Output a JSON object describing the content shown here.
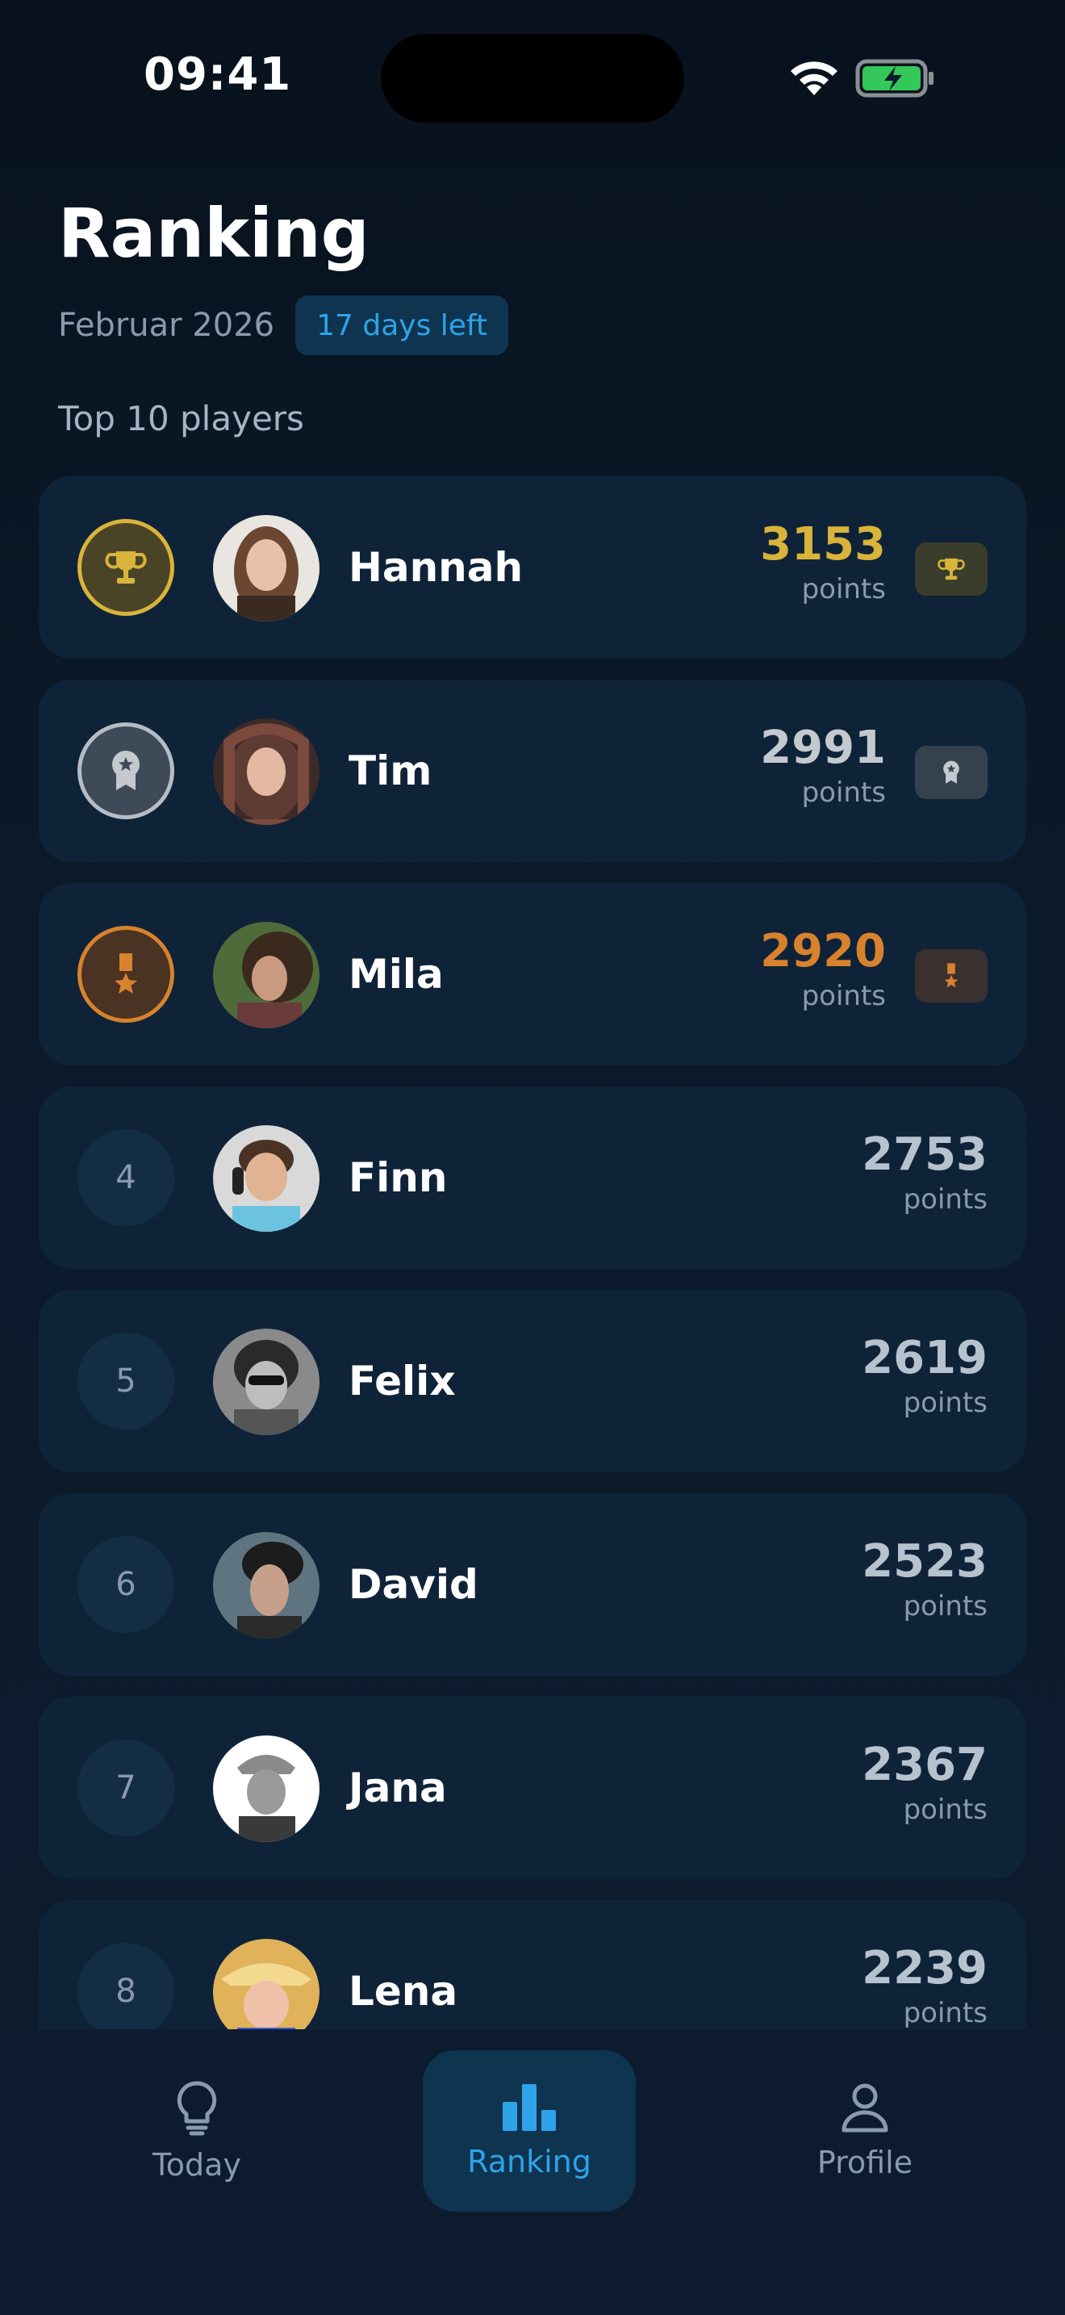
{
  "status_bar": {
    "time": "09:41"
  },
  "header": {
    "title": "Ranking",
    "month": "Februar 2026",
    "days_left": "17 days left"
  },
  "section_label": "Top 10 players",
  "players": [
    {
      "rank": "1",
      "name": "Hannah",
      "points": "3153",
      "points_label": "points",
      "medal": "gold-trophy"
    },
    {
      "rank": "2",
      "name": "Tim",
      "points": "2991",
      "points_label": "points",
      "medal": "silver-ribbon"
    },
    {
      "rank": "3",
      "name": "Mila",
      "points": "2920",
      "points_label": "points",
      "medal": "bronze-medal"
    },
    {
      "rank": "4",
      "name": "Finn",
      "points": "2753",
      "points_label": "points"
    },
    {
      "rank": "5",
      "name": "Felix",
      "points": "2619",
      "points_label": "points"
    },
    {
      "rank": "6",
      "name": "David",
      "points": "2523",
      "points_label": "points"
    },
    {
      "rank": "7",
      "name": "Jana",
      "points": "2367",
      "points_label": "points"
    },
    {
      "rank": "8",
      "name": "Lena",
      "points": "2239",
      "points_label": "points"
    }
  ],
  "nav": {
    "items": [
      {
        "label": "Today",
        "icon": "lightbulb-icon"
      },
      {
        "label": "Ranking",
        "icon": "bar-chart-icon",
        "active": true
      },
      {
        "label": "Profile",
        "icon": "person-icon"
      }
    ]
  },
  "colors": {
    "gold": "#d9b43a",
    "silver": "#b6bcc5",
    "bronze": "#d8822e",
    "accent": "#2ea3e8"
  }
}
